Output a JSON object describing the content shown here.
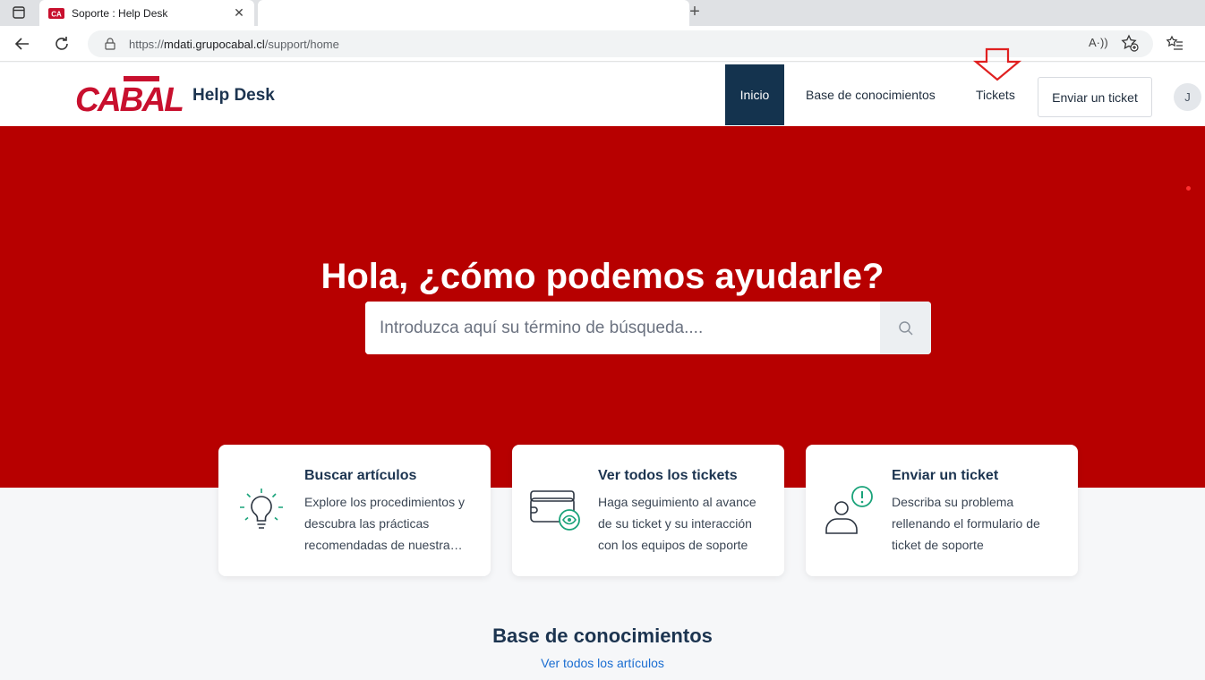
{
  "browser": {
    "tab_title": "Soporte : Help Desk",
    "url_prefix": "https://",
    "url_host": "mdati.grupocabal.cl",
    "url_path": "/support/home",
    "read_aloud": "A·))"
  },
  "header": {
    "logo_text": "CABAL",
    "brand": "Help Desk",
    "nav": {
      "inicio": "Inicio",
      "kb": "Base de conocimientos",
      "tickets": "Tickets"
    },
    "send_ticket": "Enviar un ticket",
    "avatar_initial": "J"
  },
  "hero": {
    "title": "Hola, ¿cómo podemos ayudarle?",
    "search_placeholder": "Introduzca aquí su término de búsqueda...."
  },
  "cards": [
    {
      "title": "Buscar artículos",
      "desc": "Explore los procedimientos y descubra las prácticas recomendadas de nuestra…",
      "icon": "lightbulb-icon"
    },
    {
      "title": "Ver todos los tickets",
      "desc": "Haga seguimiento al avance de su ticket y su interacción con los equipos de soporte",
      "icon": "tickets-eye-icon"
    },
    {
      "title": "Enviar un ticket",
      "desc": "Describa su problema rellenando el formulario de ticket de soporte",
      "icon": "user-alert-icon"
    }
  ],
  "kb_section": {
    "title": "Base de conocimientos",
    "link": "Ver todos los artículos"
  },
  "colors": {
    "hero_red": "#b70000",
    "nav_active": "#14334e",
    "accent_green": "#1aa37a",
    "link_blue": "#1a6dd1"
  }
}
